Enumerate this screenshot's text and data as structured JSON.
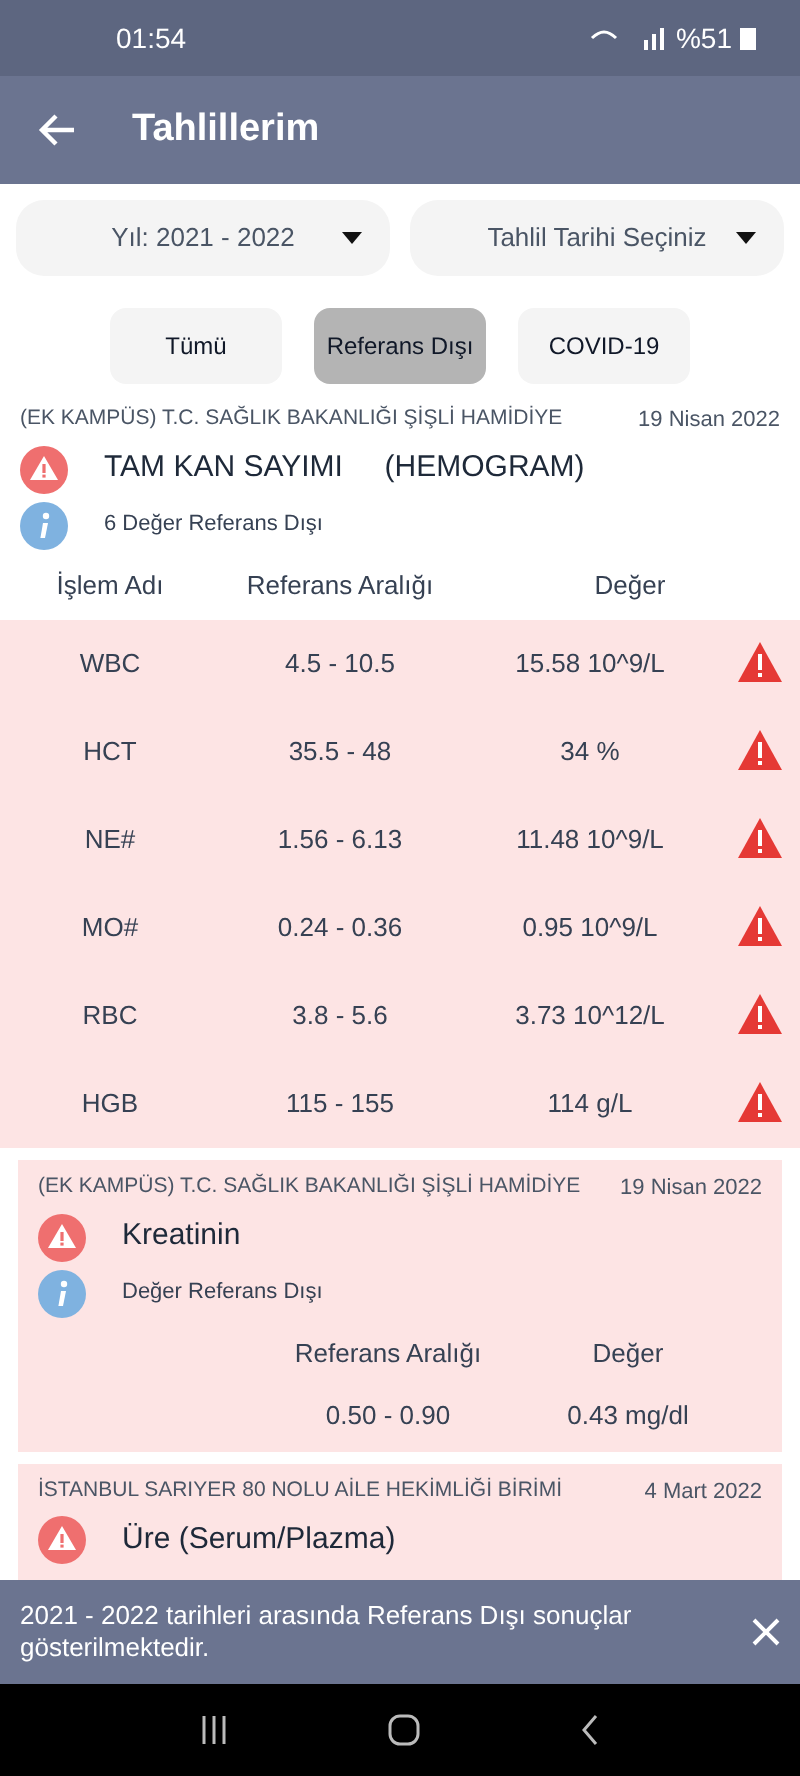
{
  "status_bar": {
    "time": "01:54",
    "battery": "%51"
  },
  "app_bar": {
    "title": "Tahlillerim"
  },
  "filters": [
    {
      "label": "Yıl: 2021 - 2022"
    },
    {
      "label": "Tahlil Tarihi Seçiniz"
    }
  ],
  "tabs": [
    {
      "label": "Tümü",
      "selected": false
    },
    {
      "label": "Referans Dışı",
      "selected": true
    },
    {
      "label": "COVID-19",
      "selected": false
    }
  ],
  "results": [
    {
      "kind": "table",
      "institution": "(EK KAMPÜS) T.C. SAĞLIK BAKANLIĞI ŞİŞLİ HAMİDİYE",
      "date": "19 Nisan 2022",
      "test": "TAM KAN SAYIMI     (HEMOGRAM)",
      "note": "6 Değer Referans Dışı",
      "columns": [
        "İşlem Adı",
        "Referans Aralığı",
        "Değer"
      ],
      "rows": [
        {
          "name": "WBC",
          "range": "4.5 - 10.5",
          "value": "15.58 10^9/L",
          "warning": true
        },
        {
          "name": "HCT",
          "range": "35.5 - 48",
          "value": "34 %",
          "warning": true
        },
        {
          "name": "NE#",
          "range": "1.56 - 6.13",
          "value": "11.48 10^9/L",
          "warning": true
        },
        {
          "name": "MO#",
          "range": "0.24 - 0.36",
          "value": "0.95 10^9/L",
          "warning": true
        },
        {
          "name": "RBC",
          "range": "3.8 - 5.6",
          "value": "3.73 10^12/L",
          "warning": true
        },
        {
          "name": "HGB",
          "range": "115 - 155",
          "value": "114 g/L",
          "warning": true
        }
      ]
    },
    {
      "kind": "single",
      "institution": "(EK KAMPÜS) T.C. SAĞLIK BAKANLIĞI ŞİŞLİ HAMİDİYE",
      "date": "19 Nisan 2022",
      "test": "Kreatinin",
      "note": "Değer Referans Dışı",
      "columns": [
        "Referans Aralığı",
        "Değer"
      ],
      "rows": [
        {
          "range": "0.50 - 0.90",
          "value": "0.43 mg/dl"
        }
      ]
    },
    {
      "kind": "single",
      "institution": "İSTANBUL SARIYER 80 NOLU AİLE HEKİMLİĞİ BİRİMİ",
      "date": "4 Mart 2022",
      "test": "Üre (Serum/Plazma)"
    }
  ],
  "snackbar": {
    "message": "2021 - 2022 tarihleri arasında Referans Dışı sonuçlar gösterilmektedir."
  }
}
